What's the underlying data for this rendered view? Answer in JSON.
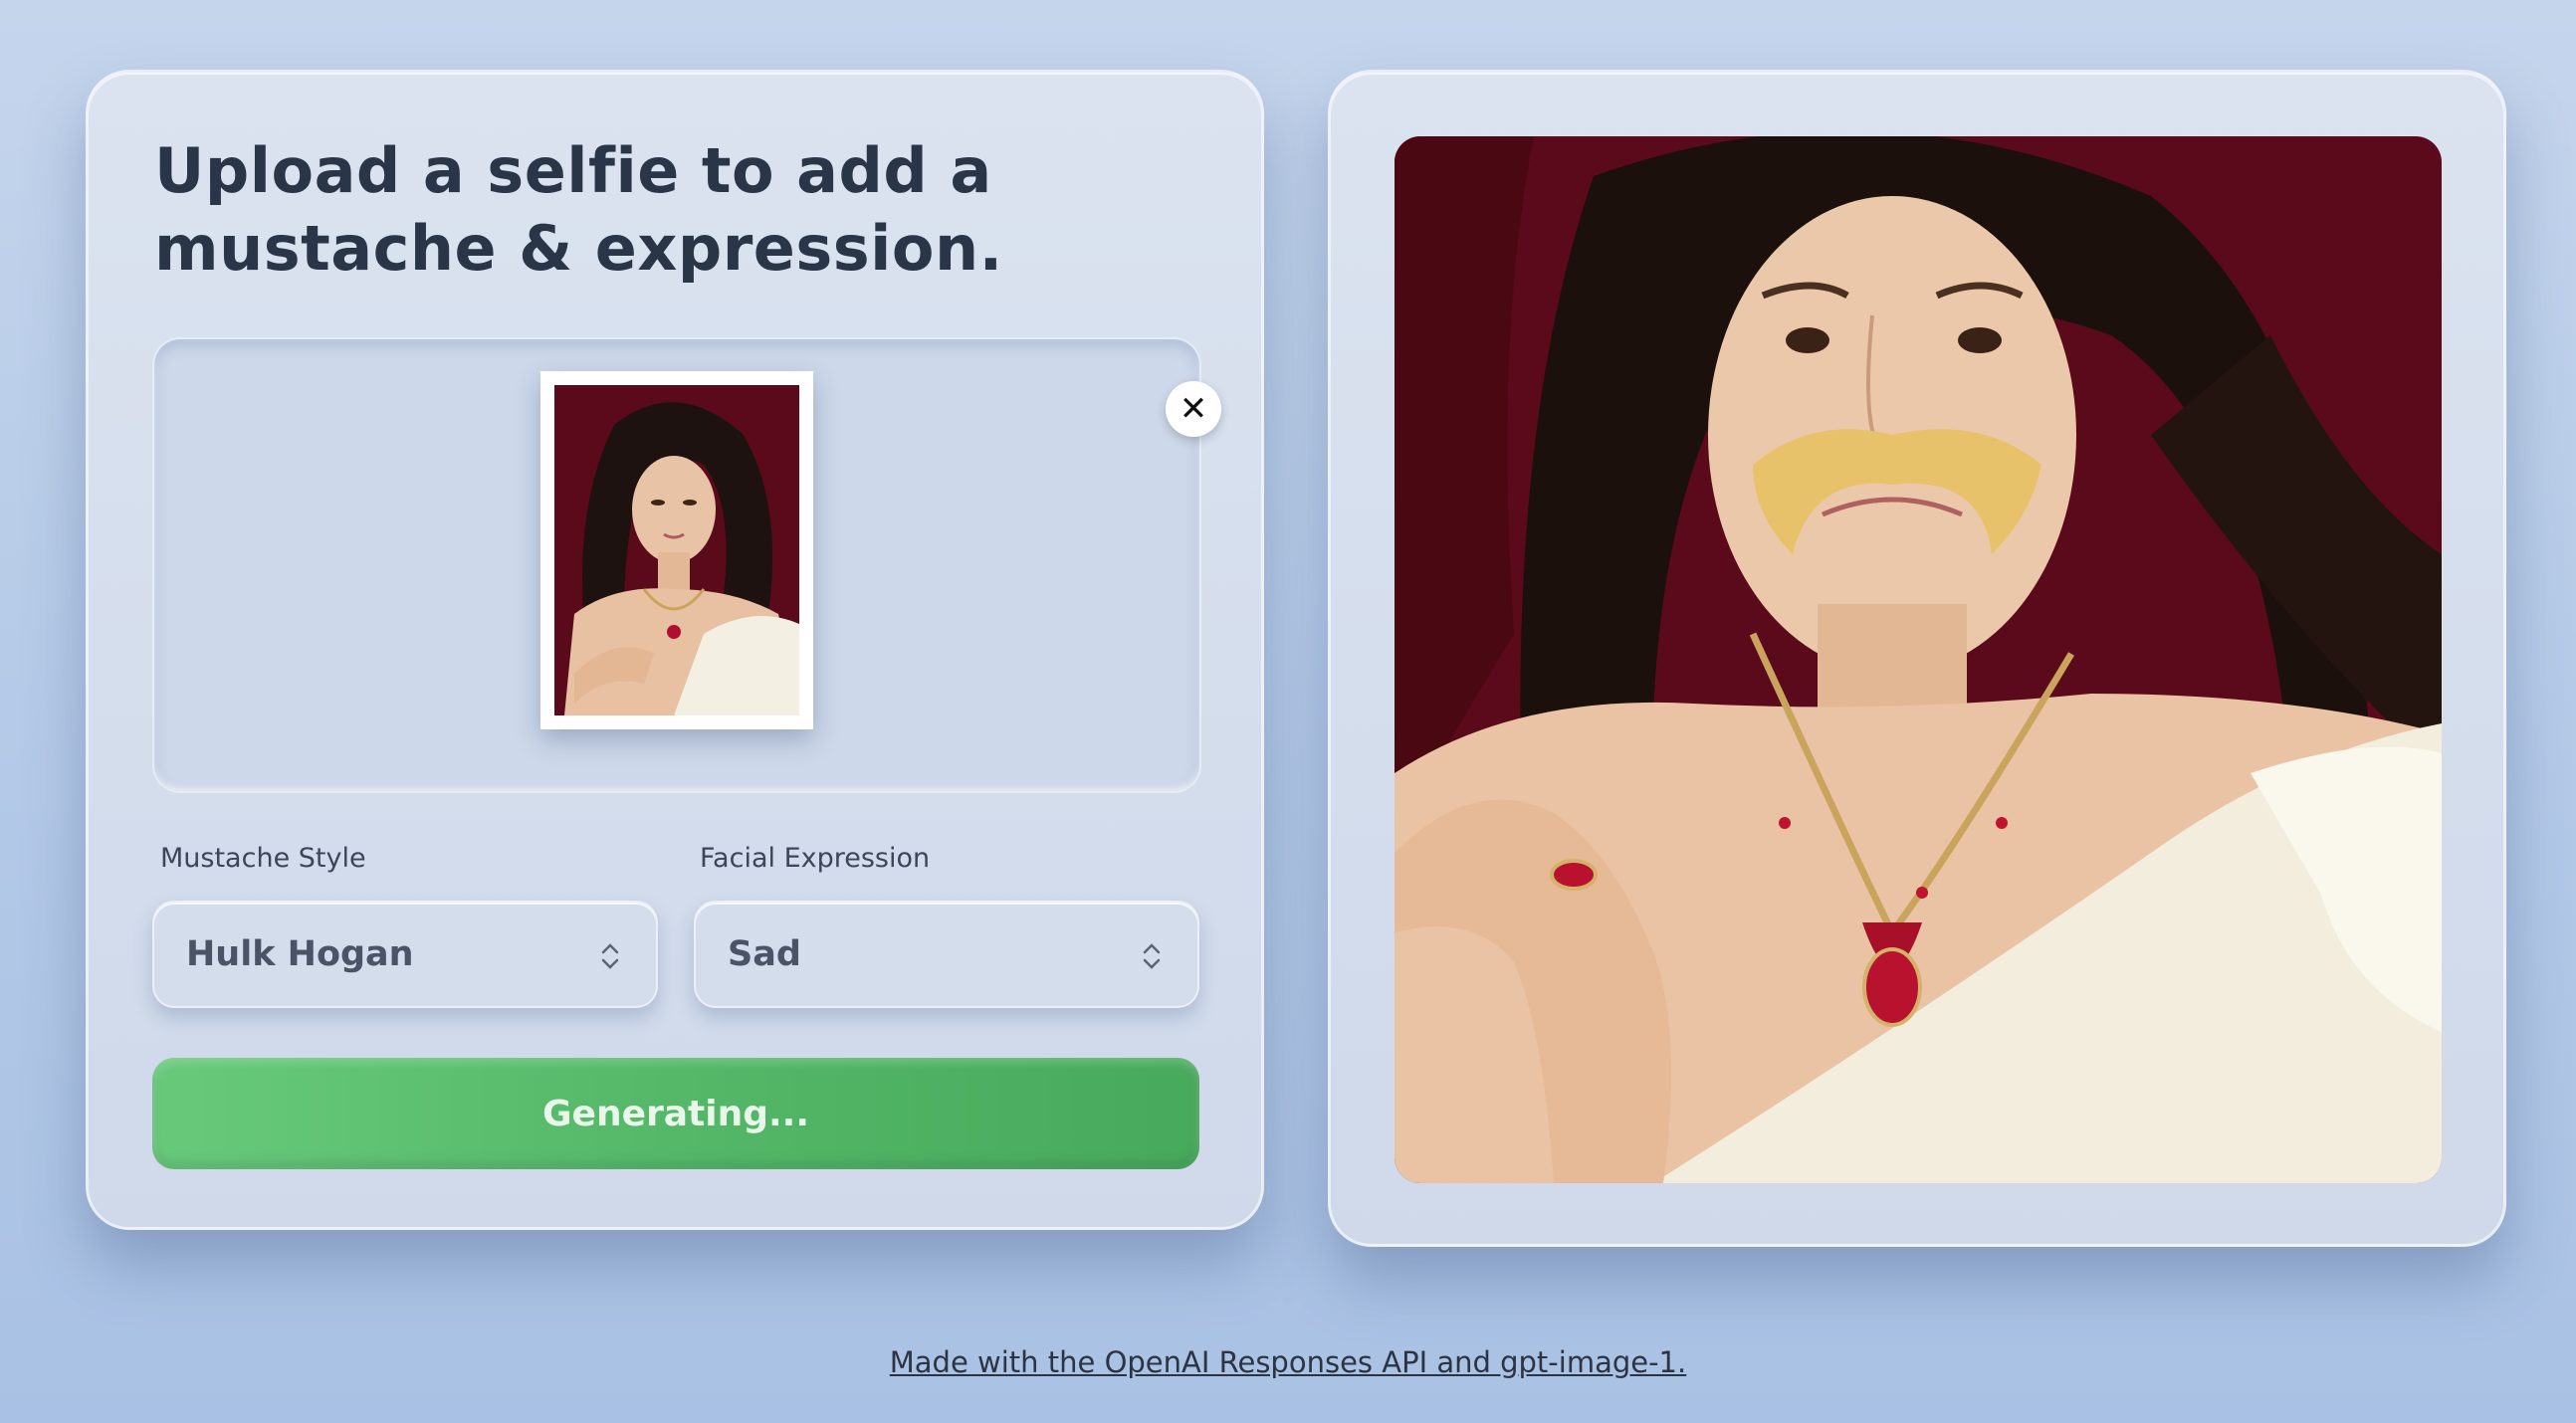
{
  "form": {
    "title": "Upload a selfie to add a mustache & expression.",
    "remove_label": "✕",
    "mustache": {
      "label": "Mustache Style",
      "value": "Hulk Hogan"
    },
    "expression": {
      "label": "Facial Expression",
      "value": "Sad"
    },
    "generate_label": "Generating..."
  },
  "footer": {
    "link_text": "Made with the OpenAI Responses API and gpt-image-1."
  },
  "colors": {
    "background": "#b3c9e7",
    "panel": "#d3dcec",
    "button_green": "#54b868",
    "photo_backdrop": "#5a0a1a"
  }
}
